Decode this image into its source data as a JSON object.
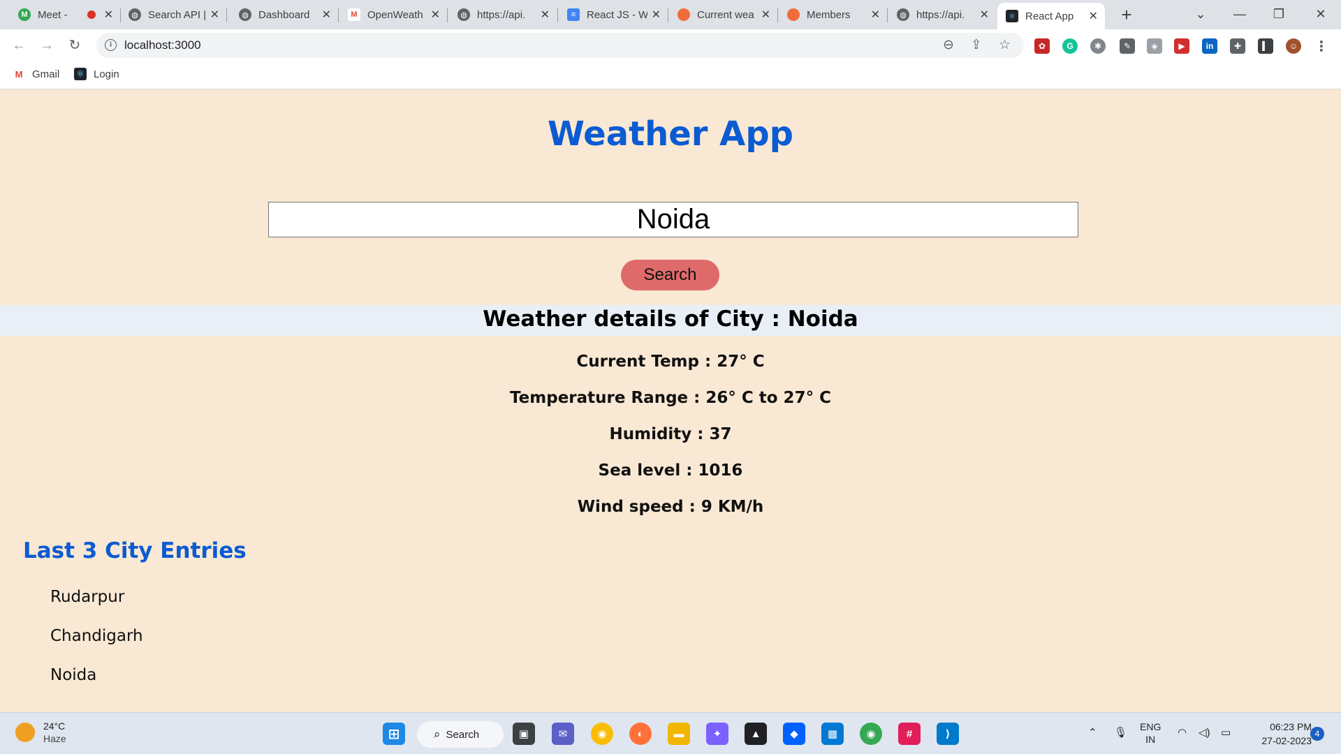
{
  "browser": {
    "tabs": [
      {
        "title": "Meet -",
        "favicon": "google-meet-icon",
        "recording": true
      },
      {
        "title": "Search API |",
        "favicon": "globe-icon"
      },
      {
        "title": "Dashboard",
        "favicon": "globe-icon"
      },
      {
        "title": "OpenWeath",
        "favicon": "gmail-icon"
      },
      {
        "title": "https://api.",
        "favicon": "globe-icon"
      },
      {
        "title": "React JS - W",
        "favicon": "google-docs-icon"
      },
      {
        "title": "Current wea",
        "favicon": "postman-icon"
      },
      {
        "title": "Members",
        "favicon": "postman-icon"
      },
      {
        "title": "https://api.",
        "favicon": "globe-icon"
      },
      {
        "title": "React App",
        "favicon": "react-icon",
        "active": true
      }
    ],
    "url": "localhost:3000",
    "bookmarks": [
      {
        "label": "Gmail",
        "icon": "gmail-icon"
      },
      {
        "label": "Login",
        "icon": "react-icon"
      }
    ]
  },
  "app": {
    "title": "Weather App",
    "search": {
      "value": "Noida",
      "button_label": "Search"
    },
    "details_heading": "Weather details of City : Noida",
    "details": [
      "Current Temp : 27° C",
      "Temperature Range : 26° C to 27° C",
      "Humidity : 37",
      "Sea level : 1016",
      "Wind speed : 9 KM/h"
    ],
    "recent_heading": "Last 3 City Entries",
    "recent_cities": [
      "Rudarpur",
      "Chandigarh",
      "Noida"
    ]
  },
  "taskbar": {
    "weather": {
      "temp": "24°C",
      "condition": "Haze"
    },
    "search_label": "Search",
    "language": {
      "line1": "ENG",
      "line2": "IN"
    },
    "time": "06:23 PM",
    "date": "27-02-2023",
    "notification_count": "4"
  },
  "colors": {
    "page_background": "#f9e8d3",
    "title_blue": "#0b5bd3",
    "search_button": "#df6a6a",
    "details_band": "#e8eff7"
  }
}
